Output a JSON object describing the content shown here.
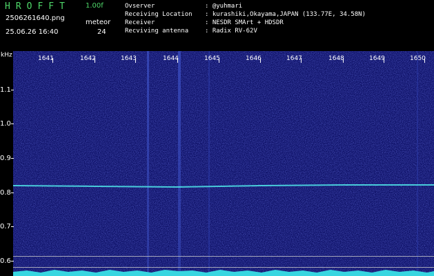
{
  "header": {
    "logo": "HROFFT",
    "version": "1.00f",
    "filename": "2506261640.png",
    "mode": "meteor",
    "datetime": "25.06.26 16:40",
    "count": "24"
  },
  "info": [
    {
      "key": "Ovserver",
      "value": ": @yuhmari"
    },
    {
      "key": "Receiving Location",
      "value": ": kurashiki,Okayama,JAPAN (133.77E, 34.58N)"
    },
    {
      "key": "Receiver",
      "value": ": NESDR SMArt + HDSDR"
    },
    {
      "key": "Recviving antenna",
      "value": ": Radix RV-62V"
    }
  ],
  "axes": {
    "unit": "kHz",
    "x_ticks": [
      "1641",
      "1642",
      "1643",
      "1644",
      "1645",
      "1646",
      "1647",
      "1648",
      "1649",
      "1650"
    ],
    "y_ticks": [
      "1.1",
      "1.0",
      "0.9",
      "0.8",
      "0.7",
      "0.6"
    ]
  },
  "colors": {
    "background": "#000000",
    "accent": "#4fd86a",
    "plot_blue": "#1a1f8c",
    "signal": "#4ee0e6"
  }
}
